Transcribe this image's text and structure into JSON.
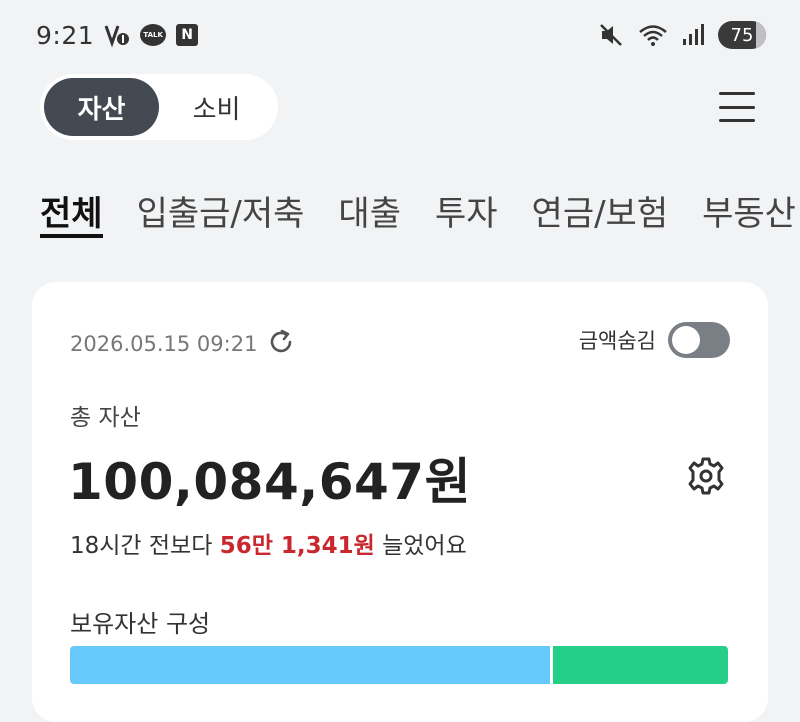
{
  "status_bar": {
    "time": "9:21",
    "battery": "75",
    "talk_badge": "TALK",
    "n_badge": "N",
    "icons": [
      "volte-icon",
      "talk-icon",
      "n-app-icon",
      "mute-icon",
      "wifi-icon",
      "signal-icon",
      "battery-icon"
    ]
  },
  "header": {
    "toggle": [
      {
        "label": "자산",
        "active": true
      },
      {
        "label": "소비",
        "active": false
      }
    ]
  },
  "tabs": [
    {
      "label": "전체",
      "active": true
    },
    {
      "label": "입출금/저축",
      "active": false
    },
    {
      "label": "대출",
      "active": false
    },
    {
      "label": "투자",
      "active": false
    },
    {
      "label": "연금/보험",
      "active": false
    },
    {
      "label": "부동산",
      "active": false
    }
  ],
  "card": {
    "timestamp": "2026.05.15 09:21",
    "hide_amount_label": "금액숨김",
    "hide_amount_on": false,
    "total_label": "총 자산",
    "total_amount": "100,084,647원",
    "change_prefix": "18시간 전보다 ",
    "change_delta": "56만 1,341원",
    "change_suffix": " 늘었어요",
    "composition_label": "보유자산 구성",
    "composition": [
      {
        "share": 0.733,
        "color": "#66c8fb"
      },
      {
        "share": 0.267,
        "color": "#25cf88"
      }
    ]
  },
  "colors": {
    "background": "#f2f3f5",
    "accent_dark": "#444a52",
    "increase_red": "#c8282e"
  }
}
